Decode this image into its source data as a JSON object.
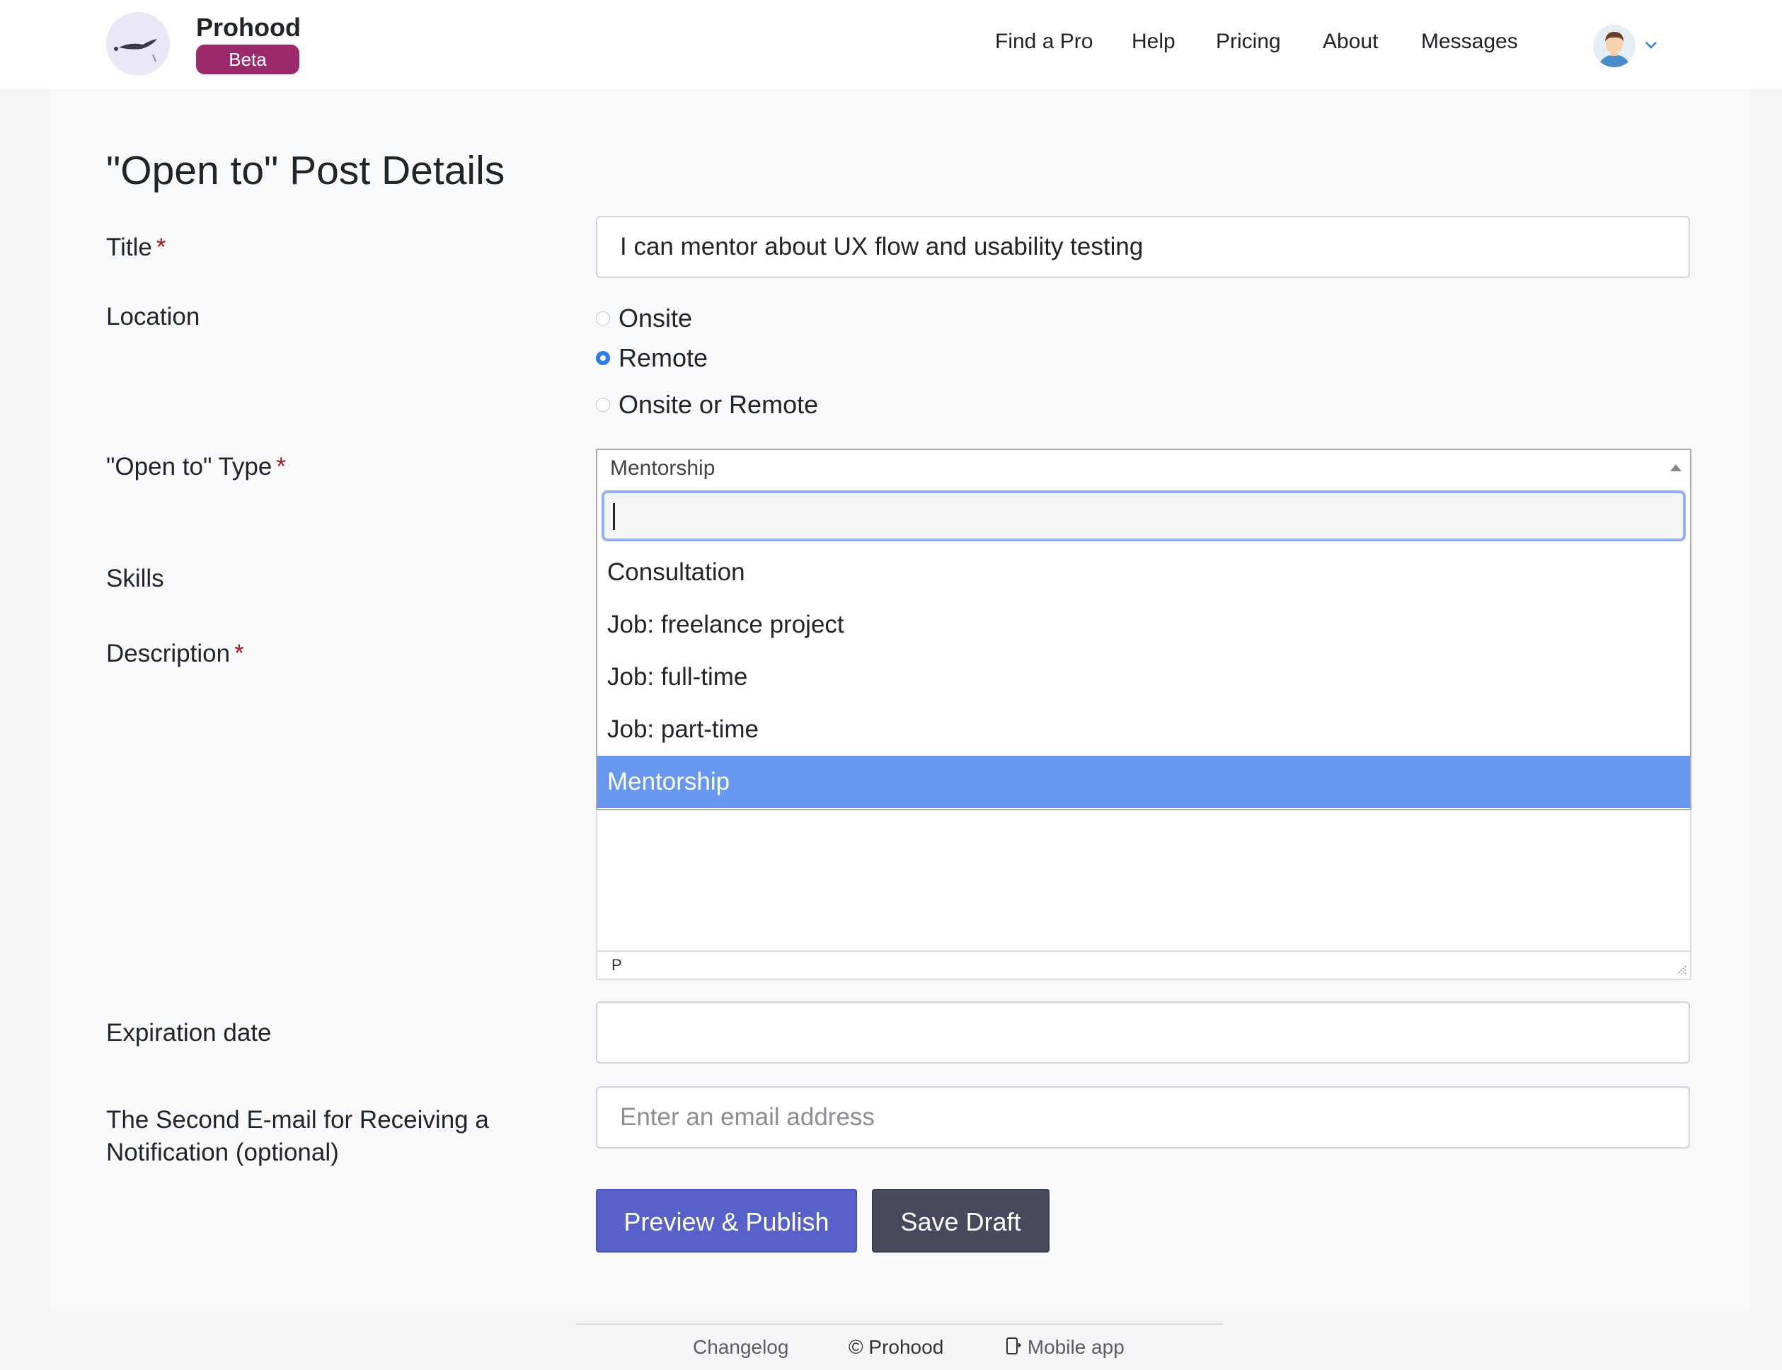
{
  "header": {
    "brand": "Prohood",
    "badge": "Beta",
    "nav": [
      "Find a Pro",
      "Help",
      "Pricing",
      "About",
      "Messages"
    ]
  },
  "form": {
    "page_title": "\"Open to\" Post Details",
    "title_label": "Title",
    "title_value": "I can mentor about UX flow and usability testing",
    "location_label": "Location",
    "location_options": [
      "Onsite",
      "Remote",
      "Onsite or Remote"
    ],
    "location_selected": "Remote",
    "type_label": "\"Open to\" Type",
    "type_selected": "Mentorship",
    "type_options": [
      "Consultation",
      "Job: freelance project",
      "Job: full-time",
      "Job: part-time",
      "Mentorship"
    ],
    "skills_label": "Skills",
    "description_label": "Description",
    "editor_status": "P",
    "expiration_label": "Expiration date",
    "expiration_value": "",
    "email_label_line1": "The Second E-mail for Receiving a",
    "email_label_line2": "Notification (optional)",
    "email_placeholder": "Enter an email address",
    "required_mark": "*"
  },
  "actions": {
    "publish": "Preview & Publish",
    "draft": "Save Draft"
  },
  "footer": {
    "changelog": "Changelog",
    "copyright": "© Prohood",
    "mobile": "Mobile app"
  },
  "colors": {
    "badge": "#9b2a6c",
    "primary_button": "#5861c9",
    "dark_button": "#474a5c",
    "selected_option": "#6897f0",
    "radio_checked": "#2f7be6",
    "required": "#a3171d"
  }
}
